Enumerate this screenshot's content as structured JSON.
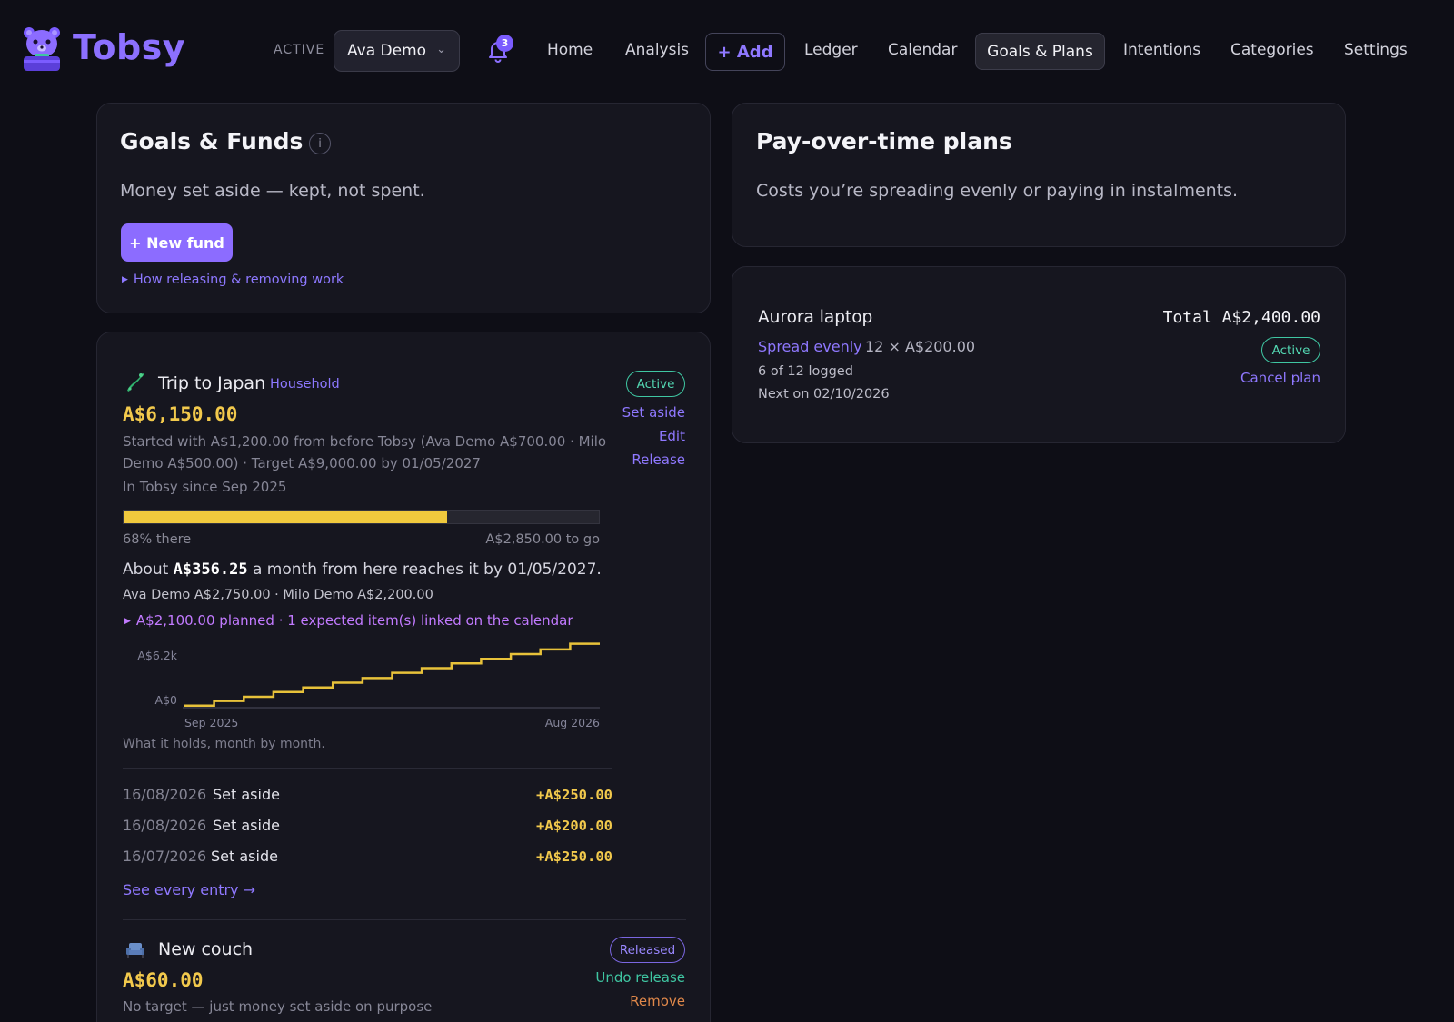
{
  "nav": {
    "logo_text": "Tobsy",
    "active_label": "ACTIVE",
    "user": "Ava Demo",
    "notifications": "3",
    "links": [
      "Home",
      "Analysis",
      "Ledger",
      "Calendar",
      "Intentions",
      "Categories",
      "Settings"
    ],
    "add_label": "+ Add",
    "current": "Goals & Plans"
  },
  "goals": {
    "title": "Goals & Funds",
    "info": "i",
    "subtitle": "Money set aside — kept, not spent.",
    "new_fund": "+ New fund",
    "how_link": "How releasing & removing work",
    "funds": [
      {
        "name": "Trip to Japan",
        "tag": "Household",
        "status": "Active",
        "actions": [
          "Set aside",
          "Edit",
          "Release"
        ],
        "amount": "A$6,150.00",
        "desc_line1": "Started with A$1,200.00 from before Tobsy (Ava Demo A$700.00 · Milo",
        "desc_line2": "Demo A$500.00) · Target A$9,000.00 by 01/05/2027",
        "since": "In Tobsy since Sep 2025",
        "progress_pct": 68,
        "progress_label": "68% there",
        "to_go": "A$2,850.00 to go",
        "about_prefix": "About",
        "about_amount": "A$356.25",
        "about_suffix": "a month from here reaches it by 01/05/2027.",
        "split": "Ava Demo A$2,750.00 · Milo Demo A$2,200.00",
        "planned": "A$2,100.00 planned · 1 expected item(s) linked on the calendar",
        "chart_caption": "What it holds, month by month.",
        "entries": [
          {
            "date": "16/08/2026",
            "label": "Set aside",
            "amount": "+A$250.00"
          },
          {
            "date": "16/08/2026",
            "label": "Set aside",
            "amount": "+A$200.00"
          },
          {
            "date": "16/07/2026",
            "label": "Set aside",
            "amount": "+A$250.00"
          }
        ],
        "see_all": "See every entry →"
      },
      {
        "name": "New couch",
        "status": "Released",
        "actions": [
          "Undo release",
          "Remove"
        ],
        "amount": "A$60.00",
        "desc": "No target — just money set aside on purpose"
      }
    ]
  },
  "chart_data": {
    "type": "line",
    "title": "",
    "x_labels": [
      "Sep 2025",
      "Aug 2026"
    ],
    "y_labels": [
      "A$6.2k",
      "A$0"
    ],
    "ylim": [
      0,
      6200
    ],
    "step": true,
    "series": [
      {
        "values": [
          200,
          650,
          1050,
          1500,
          1950,
          2400,
          2850,
          3350,
          3800,
          4250,
          4700,
          5150,
          5600,
          6150
        ]
      }
    ],
    "line_color": "#e8c23a"
  },
  "plans": {
    "title": "Pay-over-time plans",
    "subtitle": "Costs you’re spreading evenly or paying in instalments.",
    "items": [
      {
        "name": "Aurora laptop",
        "total": "Total A$2,400.00",
        "method": "Spread evenly",
        "terms": "12 × A$200.00",
        "logged": "6 of 12 logged",
        "next": "Next on 02/10/2026",
        "status": "Active",
        "cancel": "Cancel plan"
      }
    ]
  }
}
